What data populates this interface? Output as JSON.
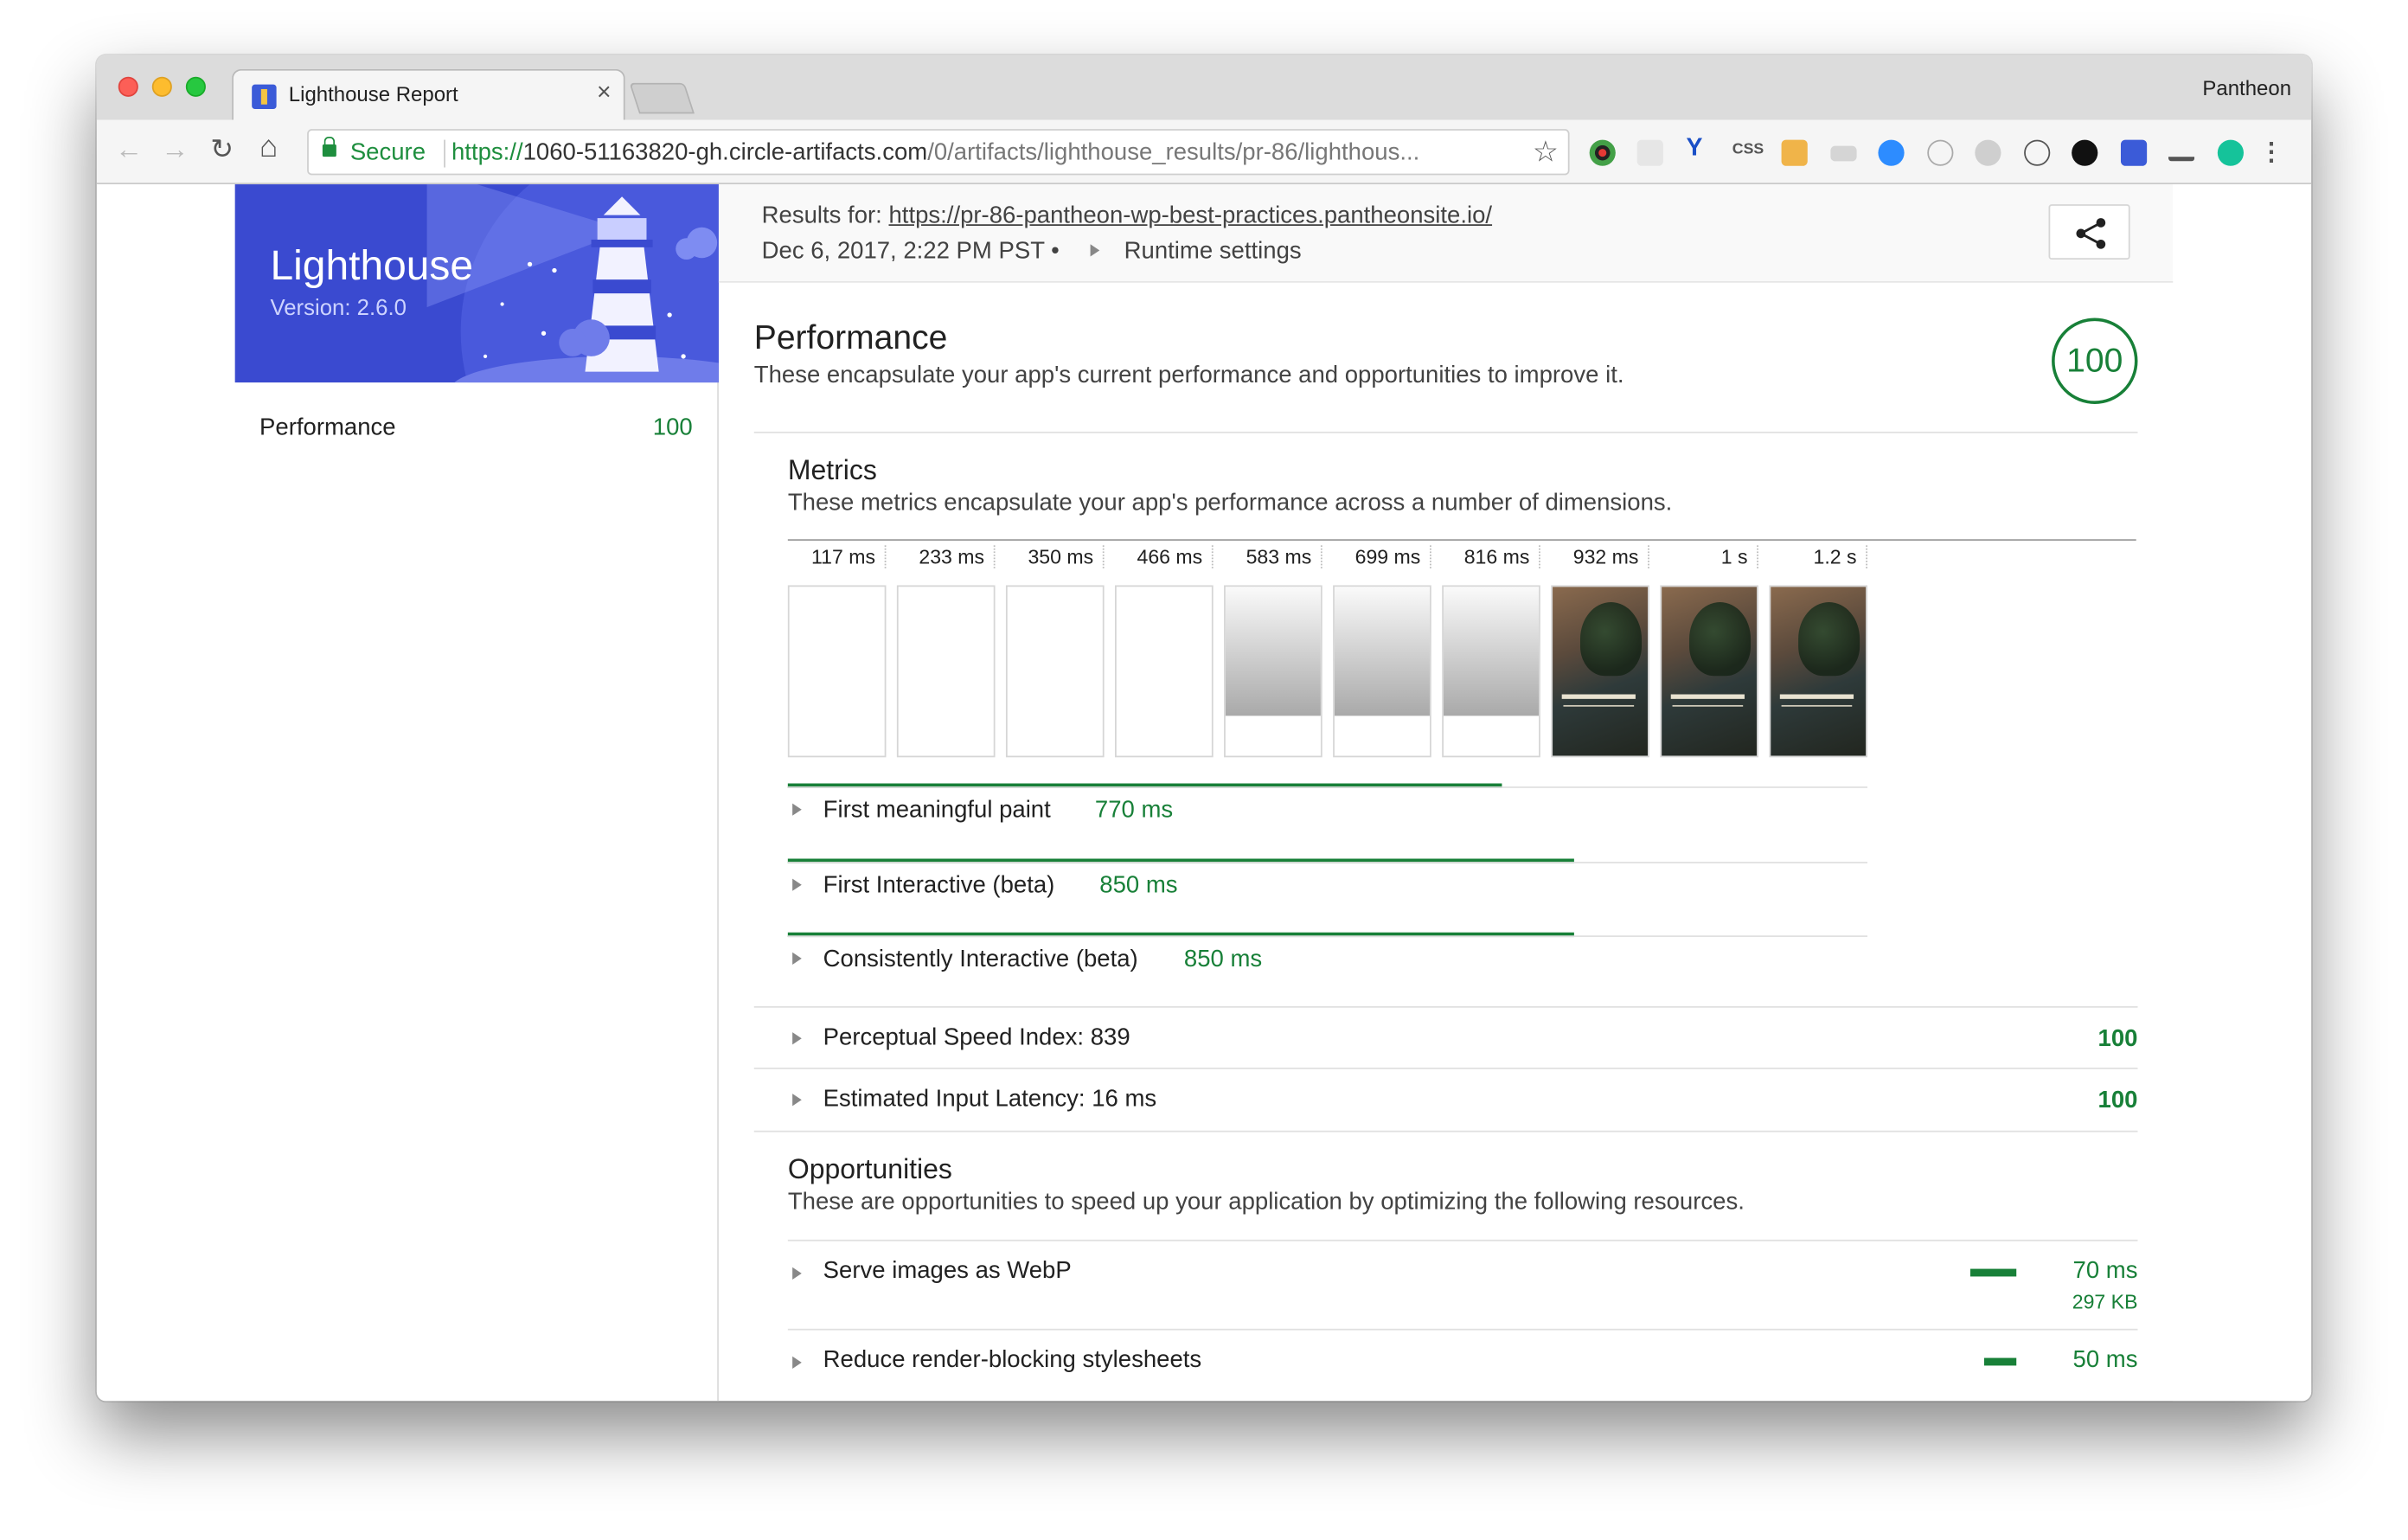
{
  "browser": {
    "tab_title": "Lighthouse Report",
    "tab_close": "×",
    "profile_name": "Pantheon",
    "secure_label": "Secure",
    "url_scheme": "https://",
    "url_host": "1060-51163820-gh.circle-artifacts.com",
    "url_path": "/0/artifacts/lighthouse_results/pr-86/lighthous...",
    "ext_text": "CSS"
  },
  "report": {
    "product": "Lighthouse",
    "version": "Version: 2.6.0",
    "results_for_label": "Results for:",
    "results_url": "https://pr-86-pantheon-wp-best-practices.pantheonsite.io/",
    "date": "Dec 6, 2017, 2:22 PM PST  •",
    "runtime_settings": "Runtime settings"
  },
  "sidebar": {
    "items": [
      {
        "label": "Performance",
        "score": "100"
      }
    ]
  },
  "performance": {
    "title": "Performance",
    "description": "These encapsulate your app's current performance and opportunities to improve it.",
    "score": "100",
    "metrics": {
      "title": "Metrics",
      "description": "These metrics encapsulate your app's performance across a number of dimensions.",
      "filmstrip": [
        {
          "label": "117 ms",
          "state": "blank"
        },
        {
          "label": "233 ms",
          "state": "blank"
        },
        {
          "label": "350 ms",
          "state": "blank"
        },
        {
          "label": "466 ms",
          "state": "blank"
        },
        {
          "label": "583 ms",
          "state": "grey"
        },
        {
          "label": "699 ms",
          "state": "grey"
        },
        {
          "label": "816 ms",
          "state": "grey"
        },
        {
          "label": "932 ms",
          "state": "image"
        },
        {
          "label": "1 s",
          "state": "image"
        },
        {
          "label": "1.2 s",
          "state": "image"
        }
      ],
      "timeline_items": [
        {
          "label": "First meaningful paint",
          "value": "770 ms",
          "fraction_of_timeline": 0.662
        },
        {
          "label": "First Interactive (beta)",
          "value": "850 ms",
          "fraction_of_timeline": 0.728
        },
        {
          "label": "Consistently Interactive (beta)",
          "value": "850 ms",
          "fraction_of_timeline": 0.728
        }
      ],
      "scored_items": [
        {
          "label": "Perceptual Speed Index: 839",
          "score": "100"
        },
        {
          "label": "Estimated Input Latency: 16 ms",
          "score": "100"
        }
      ]
    },
    "opportunities": {
      "title": "Opportunities",
      "description": "These are opportunities to speed up your application by optimizing the following resources.",
      "items": [
        {
          "label": "Serve images as WebP",
          "value": "70 ms",
          "sub": "297 KB",
          "fraction_of_max": 1.0
        },
        {
          "label": "Reduce render-blocking stylesheets",
          "value": "50 ms",
          "sub": "",
          "fraction_of_max": 0.714
        }
      ]
    }
  }
}
